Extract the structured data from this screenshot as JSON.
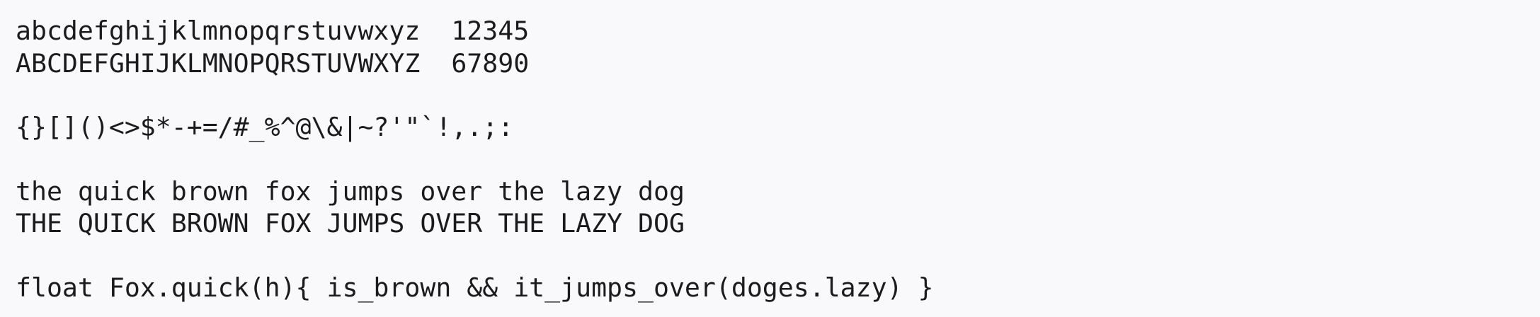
{
  "specimen": {
    "lowercase_alphabet": "abcdefghijklmnopqrstuvwxyz",
    "digits_1": "12345",
    "uppercase_alphabet": "ABCDEFGHIJKLMNOPQRSTUVWXYZ",
    "digits_2": "67890",
    "symbols": "{}[]()<>$*-+=/#_%^@\\&|~?'\"`!,.;:",
    "pangram_lower": "the quick brown fox jumps over the lazy dog",
    "pangram_upper": "THE QUICK BROWN FOX JUMPS OVER THE LAZY DOG",
    "code_sample": "float Fox.quick(h){ is_brown && it_jumps_over(doges.lazy) }"
  }
}
